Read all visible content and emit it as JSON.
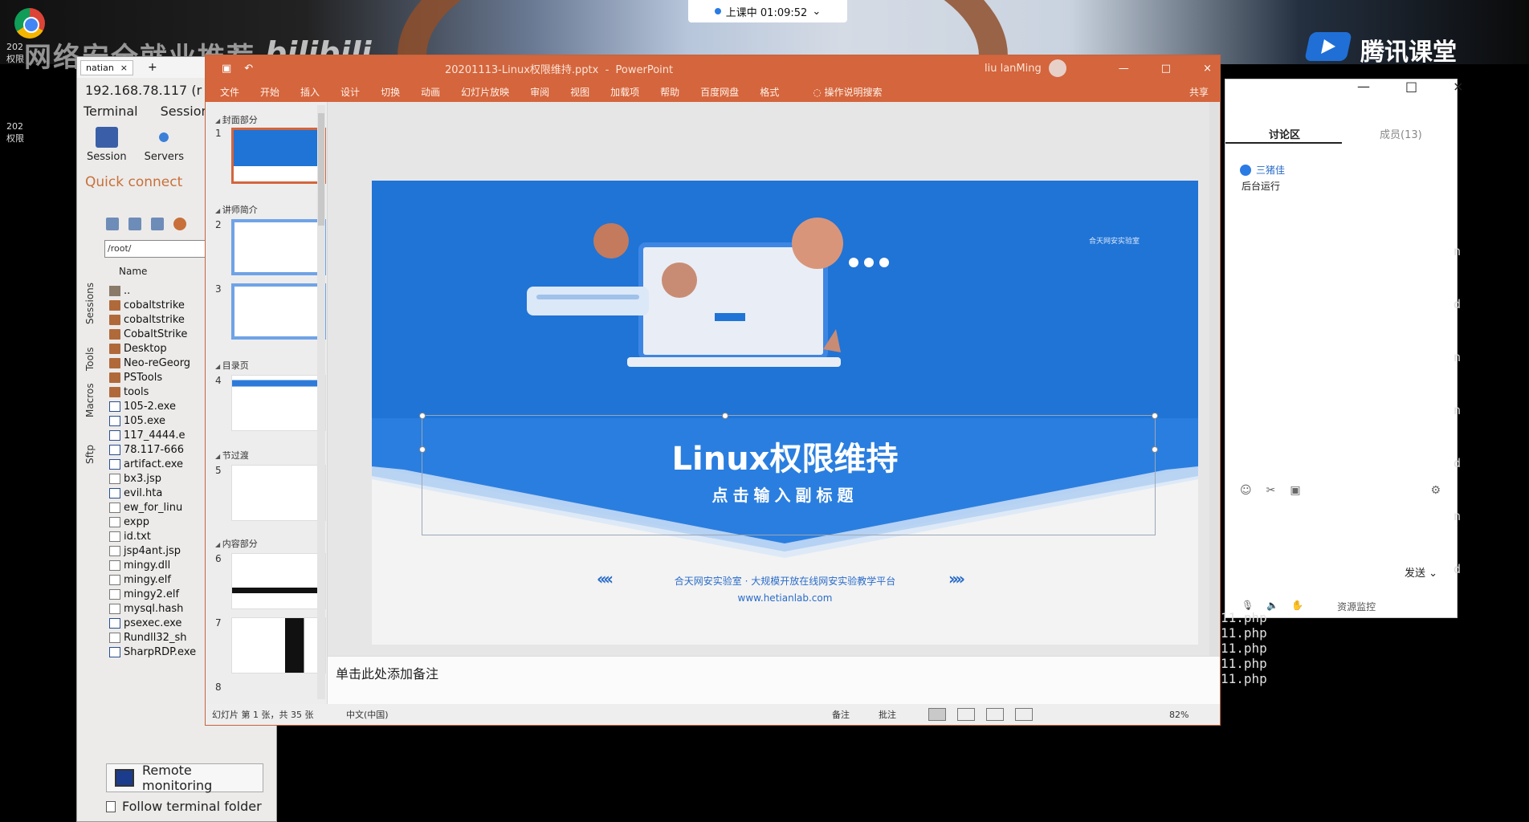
{
  "overlay": {
    "watermark": "网络安全就业推荐",
    "bili": "bilibili",
    "tencent_brand": "腾讯课堂",
    "class_timer": "上课中 01:09:52",
    "class_timer_chevron": "⌄"
  },
  "desktop": {
    "icon1_label": "202\n权限",
    "icon2_label": "202\n权限"
  },
  "moba": {
    "tab_label": "natian",
    "tab_close": "×",
    "tab_add": "+",
    "title": "192.168.78.117 (r",
    "menu": [
      "Terminal",
      "Sessions"
    ],
    "tools": [
      "Session",
      "Servers"
    ],
    "quick_connect": "Quick connect",
    "path": "/root/",
    "column_name": "Name",
    "side_tabs": [
      "Sessions",
      "Tools",
      "Macros",
      "Sftp"
    ],
    "files": [
      {
        "name": "..",
        "type": "up"
      },
      {
        "name": "cobaltstrike",
        "type": "folder"
      },
      {
        "name": "cobaltstrike",
        "type": "folder"
      },
      {
        "name": "CobaltStrike",
        "type": "folder"
      },
      {
        "name": "Desktop",
        "type": "folder"
      },
      {
        "name": "Neo-reGeorg",
        "type": "folder"
      },
      {
        "name": "PSTools",
        "type": "folder"
      },
      {
        "name": "tools",
        "type": "folder"
      },
      {
        "name": "105-2.exe",
        "type": "exe"
      },
      {
        "name": "105.exe",
        "type": "exe"
      },
      {
        "name": "117_4444.e",
        "type": "exe"
      },
      {
        "name": "78.117-666",
        "type": "exe"
      },
      {
        "name": "artifact.exe",
        "type": "exe"
      },
      {
        "name": "bx3.jsp",
        "type": "txt"
      },
      {
        "name": "evil.hta",
        "type": "exe"
      },
      {
        "name": "ew_for_linu",
        "type": "txt"
      },
      {
        "name": "expp",
        "type": "txt"
      },
      {
        "name": "id.txt",
        "type": "txt"
      },
      {
        "name": "jsp4ant.jsp",
        "type": "txt"
      },
      {
        "name": "mingy.dll",
        "type": "txt"
      },
      {
        "name": "mingy.elf",
        "type": "txt"
      },
      {
        "name": "mingy2.elf",
        "type": "txt"
      },
      {
        "name": "mysql.hash",
        "type": "txt"
      },
      {
        "name": "psexec.exe",
        "type": "exe"
      },
      {
        "name": "Rundll32_sh",
        "type": "txt"
      },
      {
        "name": "SharpRDP.exe",
        "type": "exe"
      }
    ],
    "remote_monitoring": "Remote monitoring",
    "follow_terminal": "Follow terminal folder"
  },
  "ppt": {
    "filename": "20201113-Linux权限维持.pptx",
    "app": "PowerPoint",
    "user": "liu lanMing",
    "ribbon": [
      "文件",
      "开始",
      "插入",
      "设计",
      "切换",
      "动画",
      "幻灯片放映",
      "审阅",
      "视图",
      "加载项",
      "帮助",
      "百度网盘",
      "格式"
    ],
    "search": "操作说明搜索",
    "share": "共享",
    "sections": [
      "封面部分",
      "讲师简介",
      "目录页",
      "节过渡",
      "内容部分"
    ],
    "thumb_numbers": [
      "1",
      "2",
      "3",
      "4",
      "5",
      "6",
      "7",
      "8"
    ],
    "slide": {
      "title": "Linux权限维持",
      "subtitle": "点击输入副标题",
      "brand_line": "合天网安实验室 · 大规模开放在线网安实验教学平台",
      "url": "www.hetianlab.com",
      "logo_text": "合天网安实验室",
      "chev_left": "‹‹‹‹",
      "chev_right": "››››"
    },
    "notes_placeholder": "单击此处添加备注",
    "status": {
      "slide_count": "幻灯片 第 1 张，共 35 张",
      "language": "中文(中国)",
      "notes": "备注",
      "comments": "批注",
      "zoom": "82%"
    },
    "window_controls": [
      "—",
      "□",
      "×"
    ]
  },
  "chat": {
    "tab_discussion": "讨论区",
    "tab_members": "成员(13)",
    "msg_user": "三猪佳",
    "msg_text": "后台运行",
    "send": "发送",
    "send_chevron": "⌄",
    "resource": "资源监控",
    "controls": [
      "—",
      "□",
      "×"
    ]
  },
  "terminal": {
    "lines": [
      "11.php",
      "11.php",
      "11.php",
      "11.php",
      "11.php"
    ],
    "side_letters": [
      "n",
      "d",
      "n",
      "n",
      "d",
      "n",
      "d"
    ]
  },
  "colors": {
    "ppt_accent": "#d4653c",
    "slide_blue": "#1f74d6",
    "moba_bg": "#ecebea"
  }
}
